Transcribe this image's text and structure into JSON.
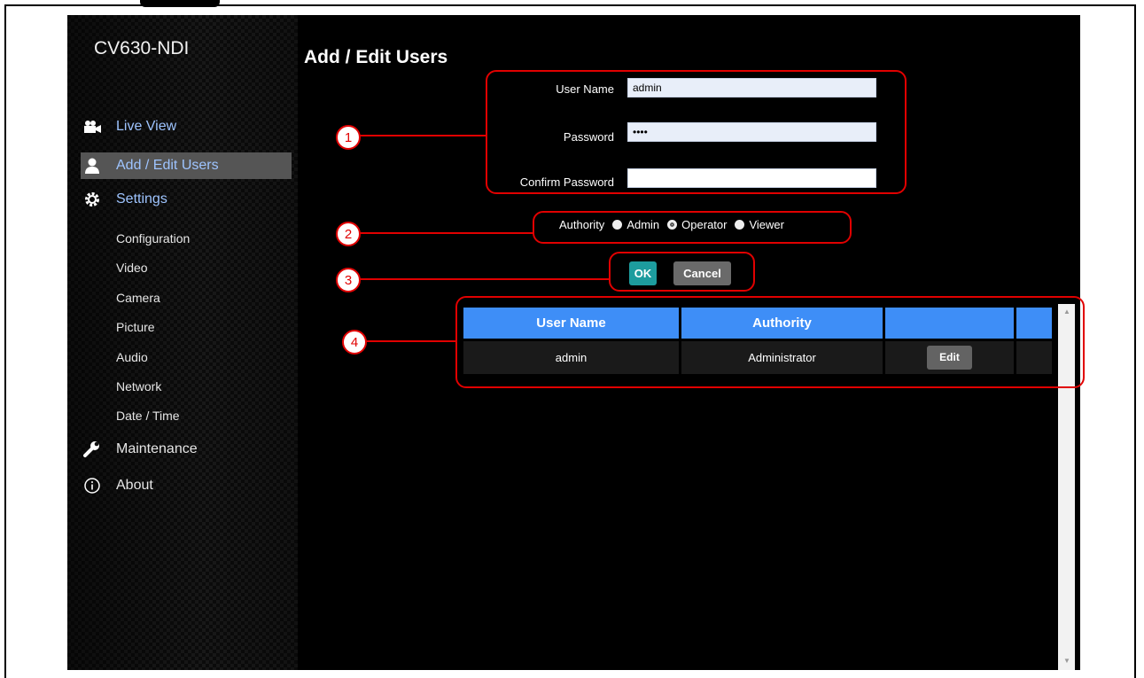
{
  "app": {
    "brand": "CV630-NDI"
  },
  "sidebar": {
    "items": [
      {
        "label": "Live View",
        "icon": "video-camera-icon"
      },
      {
        "label": "Add / Edit Users",
        "icon": "user-icon"
      },
      {
        "label": "Settings",
        "icon": "gear-icon"
      },
      {
        "label": "Maintenance",
        "icon": "wrench-icon"
      },
      {
        "label": "About",
        "icon": "info-icon"
      }
    ],
    "settings_sub": [
      "Configuration",
      "Video",
      "Camera",
      "Picture",
      "Audio",
      "Network",
      "Date / Time"
    ],
    "active": "Add / Edit Users"
  },
  "main": {
    "title": "Add / Edit Users",
    "form": {
      "username_label": "User Name",
      "username_value": "admin",
      "password_label": "Password",
      "password_value": "••••",
      "confirm_label": "Confirm Password",
      "confirm_value": ""
    },
    "authority": {
      "label": "Authority",
      "options": [
        "Admin",
        "Operator",
        "Viewer"
      ],
      "selected": "Operator"
    },
    "buttons": {
      "ok": "OK",
      "cancel": "Cancel"
    },
    "table": {
      "headers": [
        "User Name",
        "Authority",
        "",
        ""
      ],
      "rows": [
        {
          "user": "admin",
          "authority": "Administrator",
          "action": "Edit"
        }
      ]
    }
  },
  "annotations": [
    "1",
    "2",
    "3",
    "4"
  ],
  "colors": {
    "accent_blue": "#3e8ef7",
    "ok_teal": "#1d9c9e",
    "callout_red": "#e10000",
    "active_nav": "#555555"
  }
}
